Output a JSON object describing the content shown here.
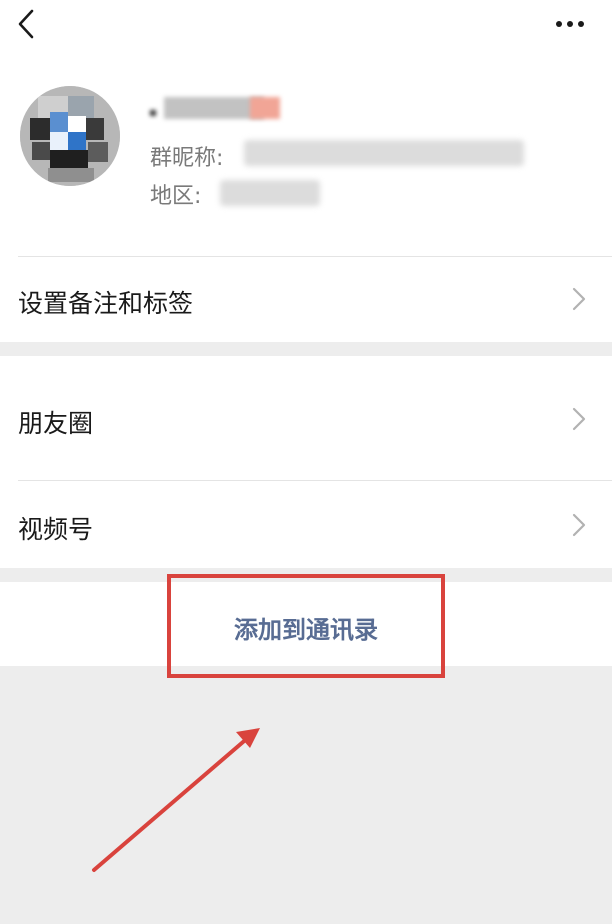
{
  "profile": {
    "nickname_label": "群昵称:",
    "region_label": "地区:"
  },
  "menu": {
    "remark_tags": "设置备注和标签",
    "moments": "朋友圈",
    "channels": "视频号"
  },
  "action": {
    "add_to_contacts": "添加到通讯录"
  },
  "icons": {
    "back": "chevron-left-icon",
    "more": "more-dots-icon",
    "row_arrow": "chevron-right-icon"
  },
  "colors": {
    "background": "#ededed",
    "card": "#ffffff",
    "link_text": "#586c93",
    "annotation_red": "#d9433d"
  }
}
